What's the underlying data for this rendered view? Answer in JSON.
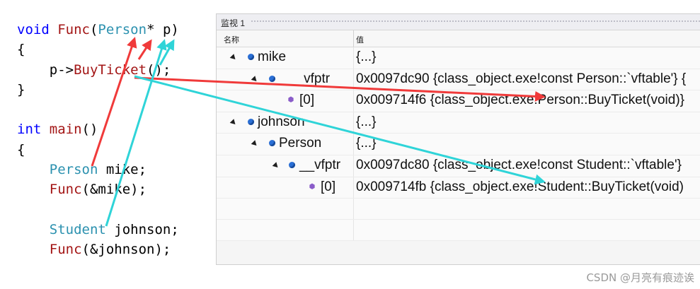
{
  "code": {
    "lines": [
      [
        {
          "c": "kw",
          "t": "void "
        },
        {
          "c": "fn",
          "t": "Func"
        },
        {
          "c": "pl",
          "t": "("
        },
        {
          "c": "ty",
          "t": "Person"
        },
        {
          "c": "pl",
          "t": "* p)"
        }
      ],
      [
        {
          "c": "pl",
          "t": "{"
        }
      ],
      [
        {
          "c": "pl",
          "t": "    p->"
        },
        {
          "c": "fn",
          "t": "BuyTicket"
        },
        {
          "c": "pl",
          "t": "();"
        }
      ],
      [
        {
          "c": "pl",
          "t": "}"
        }
      ],
      [
        {
          "c": "pl",
          "t": ""
        }
      ],
      [
        {
          "c": "kw",
          "t": "int "
        },
        {
          "c": "fn",
          "t": "main"
        },
        {
          "c": "pl",
          "t": "()"
        }
      ],
      [
        {
          "c": "pl",
          "t": "{"
        }
      ],
      [
        {
          "c": "ty",
          "t": "    Person"
        },
        {
          "c": "pl",
          "t": " mike;"
        }
      ],
      [
        {
          "c": "fn",
          "t": "    Func"
        },
        {
          "c": "pl",
          "t": "(&mike);"
        }
      ],
      [
        {
          "c": "pl",
          "t": ""
        }
      ],
      [
        {
          "c": "ty",
          "t": "    Student"
        },
        {
          "c": "pl",
          "t": " johnson;"
        }
      ],
      [
        {
          "c": "fn",
          "t": "    Func"
        },
        {
          "c": "pl",
          "t": "(&johnson);"
        }
      ]
    ],
    "colors": {
      "kw": "#0000ff",
      "fn": "#a31515",
      "ty": "#2b91af",
      "pl": "#000000"
    }
  },
  "watch": {
    "title": "监视 1",
    "col_name": "名称",
    "col_value": "值",
    "rows": [
      {
        "name": "mike",
        "value": "{...}",
        "icon": "field-icon",
        "expander": true
      },
      {
        "name": "__vfptr",
        "value": "0x0097dc90 {class_object.exe!const Person::`vftable'} {",
        "icon": "field-icon",
        "expander": true
      },
      {
        "name": "[0]",
        "value": "0x009714f6 {class_object.exe!Person::BuyTicket(void)}",
        "icon": "method-icon",
        "expander": false
      },
      {
        "name": "johnson",
        "value": "{...}",
        "icon": "field-icon",
        "expander": true
      },
      {
        "name": "Person",
        "value": "{...}",
        "icon": "field-icon",
        "expander": true
      },
      {
        "name": "__vfptr",
        "value": "0x0097dc80 {class_object.exe!const Student::`vftable'}",
        "icon": "field-icon",
        "expander": true
      },
      {
        "name": "[0]",
        "value": "0x009714fb {class_object.exe!Student::BuyTicket(void)",
        "icon": "method-icon",
        "expander": false
      }
    ]
  },
  "watermark": "CSDN @月亮有痕迹诶",
  "arrow_colors": {
    "red": "#f03a3a",
    "cyan": "#2fd4d8"
  }
}
